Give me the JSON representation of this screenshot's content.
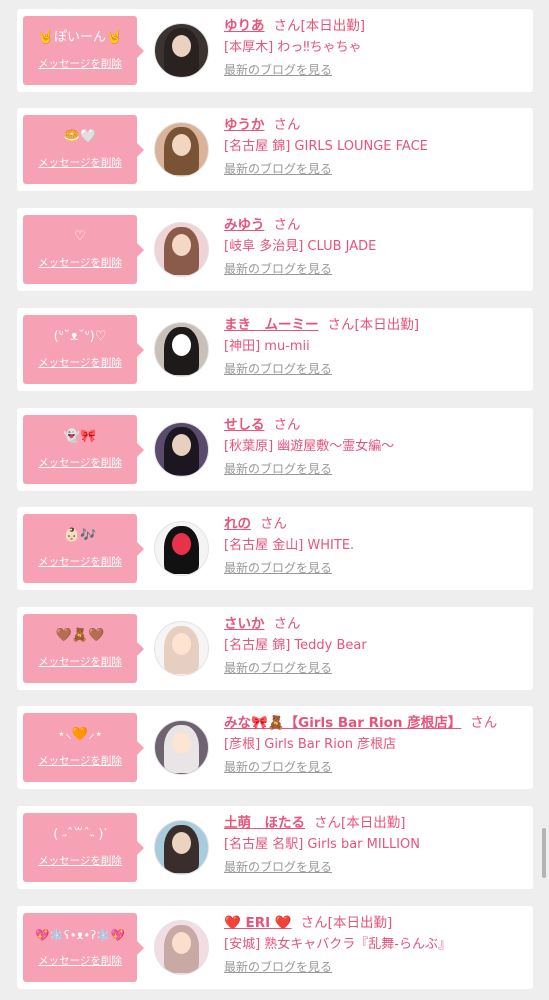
{
  "delete_label": "メッセージを削除",
  "blog_label": "最新のブログを見る",
  "honorific": "さん",
  "accent_color": "#e8537a",
  "bubble_color": "#f6a1b4",
  "messages": [
    {
      "bubble": "🤘ぽいーん🤘",
      "name": "ゆりあ",
      "status": "[本日出勤]",
      "shop": "[本厚木] わっ‼ちゃちゃ",
      "avatar": "photo-dark"
    },
    {
      "bubble": "🥯🤍",
      "name": "ゆうか",
      "status": "",
      "shop": "[名古屋 錦] GIRLS LOUNGE FACE",
      "avatar": "photo-light"
    },
    {
      "bubble": "♡",
      "name": "みゆう",
      "status": "",
      "shop": "[岐阜 多治見] CLUB JADE",
      "avatar": "photo-pink"
    },
    {
      "bubble": "(ᐡ˘ᴥ˘ᐡ)♡",
      "name": "まき　ムーミー",
      "status": "[本日出勤]",
      "shop": "[神田] mu-mii",
      "avatar": "photo-dark"
    },
    {
      "bubble": "👻🎀",
      "name": "せしる",
      "status": "",
      "shop": "[秋葉原] 幽遊屋敷〜霊女編〜",
      "avatar": "photo-purple"
    },
    {
      "bubble": "👶🏻🎶",
      "name": "れの",
      "status": "",
      "shop": "[名古屋 金山] WHITE.",
      "avatar": "photo-black"
    },
    {
      "bubble": "🤎🧸🤎",
      "name": "さいか",
      "status": "",
      "shop": "[名古屋 錦] Teddy Bear",
      "avatar": "photo-white"
    },
    {
      "bubble": "⋆⸜🧡⸝⋆",
      "name": "みな🎀🧸【Girls Bar Rion 彦根店】",
      "status": "",
      "shop": "[彦根] Girls Bar Rion 彦根店",
      "avatar": "photo-dark"
    },
    {
      "bubble": "( ˶ˆ꒳ˆ˵ )ᐝ",
      "name": "土萌　ほたる",
      "status": "[本日出勤]",
      "shop": "[名古屋 名駅] Girls bar MILLION",
      "avatar": "photo-blue"
    },
    {
      "bubble": "💖❄️ʕ•ᴥ•ʔ❄️💖",
      "name": "❤️ ERI ❤️",
      "status": "[本日出勤]",
      "shop": "[安城] 熟女キャバクラ『乱舞-らんぶ』",
      "avatar": "photo-pink"
    }
  ]
}
